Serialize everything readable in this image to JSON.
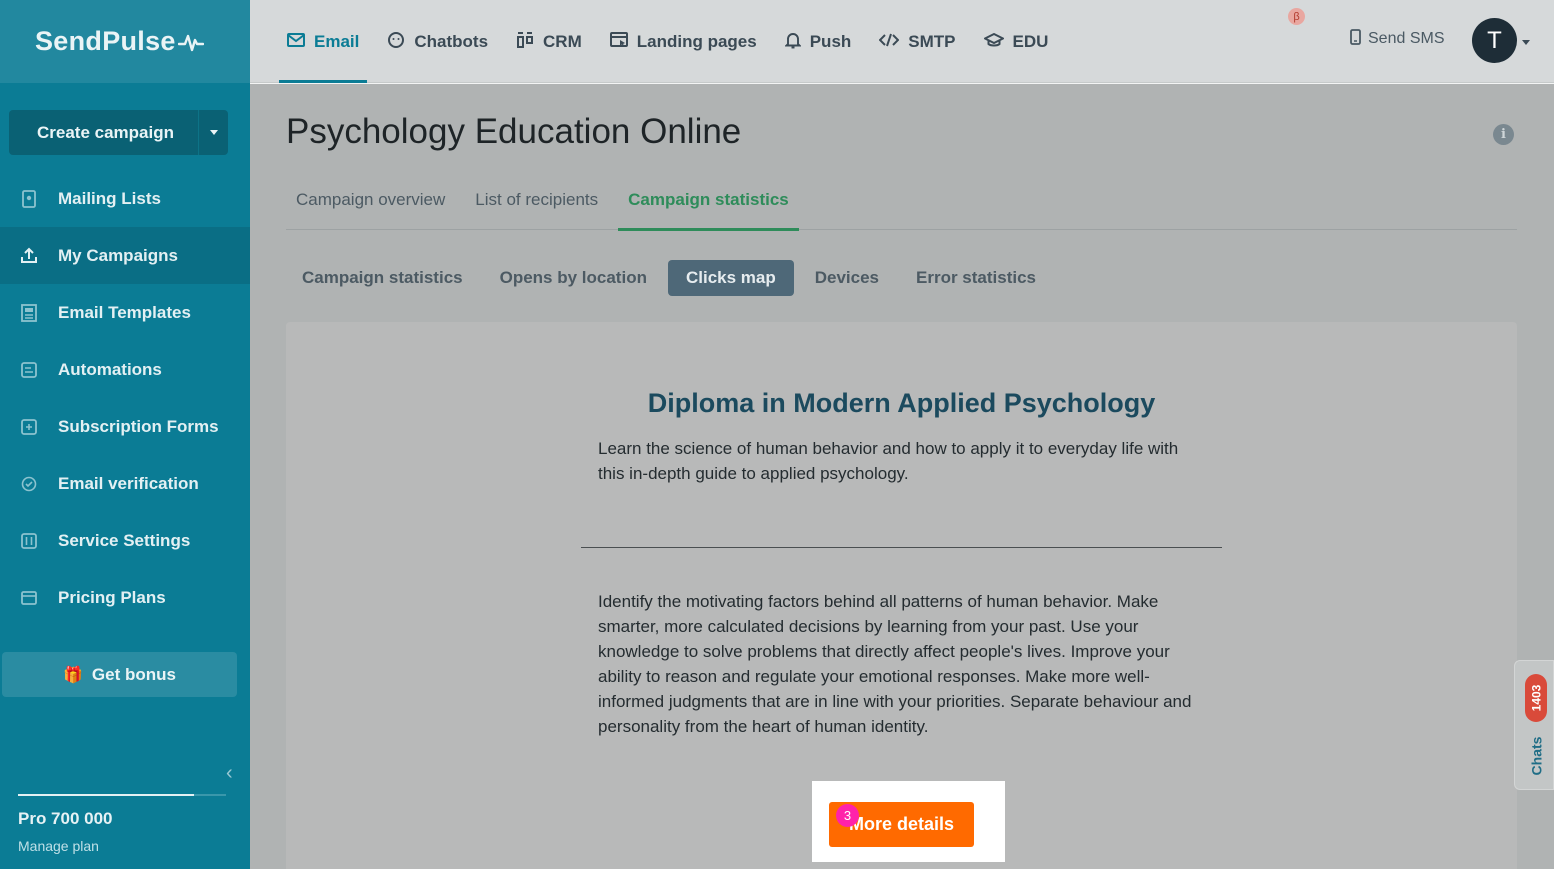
{
  "sidebar": {
    "logo": "SendPulse",
    "create_button": "Create campaign",
    "items": [
      {
        "label": "Mailing Lists"
      },
      {
        "label": "My Campaigns"
      },
      {
        "label": "Email Templates"
      },
      {
        "label": "Automations"
      },
      {
        "label": "Subscription Forms"
      },
      {
        "label": "Email verification"
      },
      {
        "label": "Service Settings"
      },
      {
        "label": "Pricing Plans"
      }
    ],
    "bonus_label": "Get bonus",
    "plan_name": "Pro 700 000",
    "manage_label": "Manage plan"
  },
  "topnav": {
    "items": [
      {
        "label": "Email"
      },
      {
        "label": "Chatbots"
      },
      {
        "label": "CRM"
      },
      {
        "label": "Landing pages"
      },
      {
        "label": "Push"
      },
      {
        "label": "SMTP"
      },
      {
        "label": "EDU"
      }
    ],
    "beta_badge": "β",
    "send_sms": "Send SMS",
    "avatar_letter": "T"
  },
  "page": {
    "title": "Psychology Education Online",
    "tabs": [
      {
        "label": "Campaign overview"
      },
      {
        "label": "List of recipients"
      },
      {
        "label": "Campaign statistics"
      }
    ],
    "subtabs": [
      {
        "label": "Campaign statistics"
      },
      {
        "label": "Opens by location"
      },
      {
        "label": "Clicks map"
      },
      {
        "label": "Devices"
      },
      {
        "label": "Error statistics"
      }
    ]
  },
  "email": {
    "title": "Diploma in Modern Applied Psychology",
    "intro": "Learn the science of human behavior and how to apply it to everyday life with this in-depth guide to applied psychology.",
    "body": "Identify the motivating factors behind all patterns of human behavior. Make smarter, more calculated decisions by learning from your past. Use your knowledge to solve problems that directly affect people's lives. Improve your ability to reason and regulate your emotional responses. Make more well-informed judgments that are in line with your priorities. Separate behaviour and personality from the heart of human identity.",
    "cta_label": "More details",
    "click_count": "3"
  },
  "chats": {
    "count": "1403",
    "label": "Chats"
  },
  "colors": {
    "sidebar": "#0b7c95",
    "accent_green": "#2e8c5a",
    "cta_orange": "#ff6a00",
    "click_badge": "#ff22aa"
  }
}
